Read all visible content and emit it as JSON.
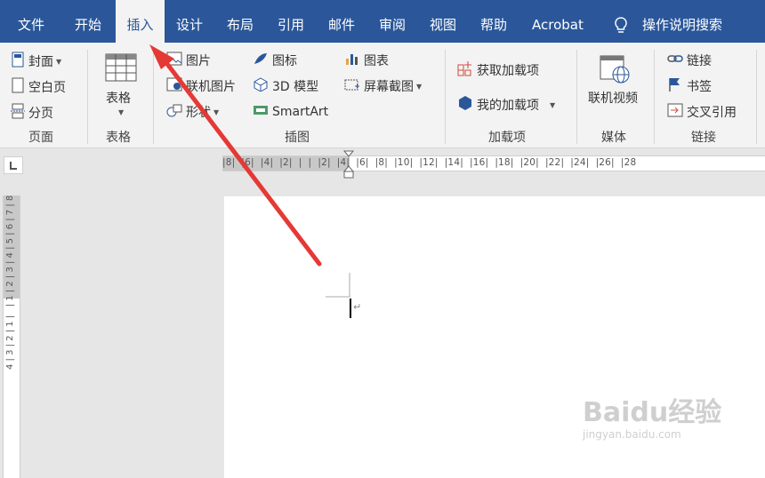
{
  "menu": {
    "tabs": [
      {
        "label": "文件"
      },
      {
        "label": "开始"
      },
      {
        "label": "插入"
      },
      {
        "label": "设计"
      },
      {
        "label": "布局"
      },
      {
        "label": "引用"
      },
      {
        "label": "邮件"
      },
      {
        "label": "审阅"
      },
      {
        "label": "视图"
      },
      {
        "label": "帮助"
      },
      {
        "label": "Acrobat"
      }
    ],
    "search_label": "操作说明搜索"
  },
  "ribbon": {
    "pages_group": {
      "cover": "封面",
      "blank": "空白页",
      "break": "分页",
      "label": "页面"
    },
    "table_group": {
      "table": "表格",
      "label": "表格"
    },
    "illustrations_group": {
      "picture": "图片",
      "online_picture": "联机图片",
      "shapes": "形状",
      "icons": "图标",
      "model3d": "3D 模型",
      "smartart": "SmartArt",
      "chart": "图表",
      "screenshot": "屏幕截图",
      "label": "插图"
    },
    "addins_group": {
      "get": "获取加载项",
      "my": "我的加载项",
      "label": "加载项"
    },
    "media_group": {
      "video": "联机视频",
      "label": "媒体"
    },
    "links_group": {
      "link": "链接",
      "bookmark": "书签",
      "crossref": "交叉引用",
      "label": "链接"
    }
  },
  "ruler": {
    "horizontal": "|8|  |6|  |4|  |2|  |  |  |2|  |4|  |6|  |8|  |10|  |12|  |14|  |16|  |18|  |20|  |22|  |24|  |26|  |28",
    "vertical": "4 | 3 | 2 | 1 |   | 1 | 2 | 3 | 4 | 5 | 6 | 7 | 8"
  },
  "watermark": {
    "brand": "Baidu经验",
    "url": "jingyan.baidu.com"
  },
  "colors": {
    "ribbon_blue": "#2b579a",
    "arrow_red": "#e53935"
  }
}
